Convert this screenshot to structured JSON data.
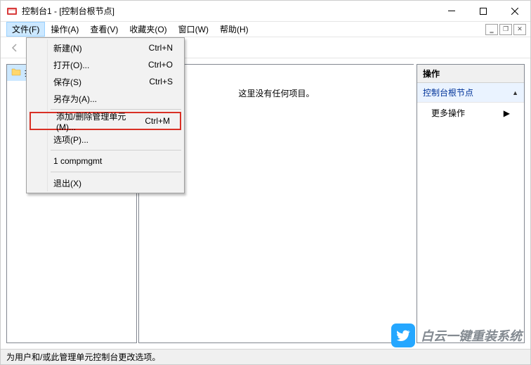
{
  "window": {
    "title": "控制台1 - [控制台根节点]"
  },
  "menubar": {
    "items": [
      {
        "label": "文件(F)"
      },
      {
        "label": "操作(A)"
      },
      {
        "label": "查看(V)"
      },
      {
        "label": "收藏夹(O)"
      },
      {
        "label": "窗口(W)"
      },
      {
        "label": "帮助(H)"
      }
    ]
  },
  "dropdown": {
    "items": [
      {
        "label": "新建(N)",
        "shortcut": "Ctrl+N"
      },
      {
        "label": "打开(O)...",
        "shortcut": "Ctrl+O"
      },
      {
        "label": "保存(S)",
        "shortcut": "Ctrl+S"
      },
      {
        "label": "另存为(A)...",
        "shortcut": ""
      }
    ],
    "highlighted": {
      "label": "添加/删除管理单元(M)...",
      "shortcut": "Ctrl+M"
    },
    "options": {
      "label": "选项(P)...",
      "shortcut": ""
    },
    "recent": {
      "label": "1 compmgmt",
      "shortcut": ""
    },
    "exit": {
      "label": "退出(X)",
      "shortcut": ""
    }
  },
  "tree": {
    "root": "控制台根节点"
  },
  "content": {
    "empty": "这里没有任何项目。"
  },
  "actions": {
    "header": "操作",
    "sub": "控制台根节点",
    "more": "更多操作"
  },
  "statusbar": "为用户和/或此管理单元控制台更改选项。",
  "watermark": "白云一键重装系统"
}
